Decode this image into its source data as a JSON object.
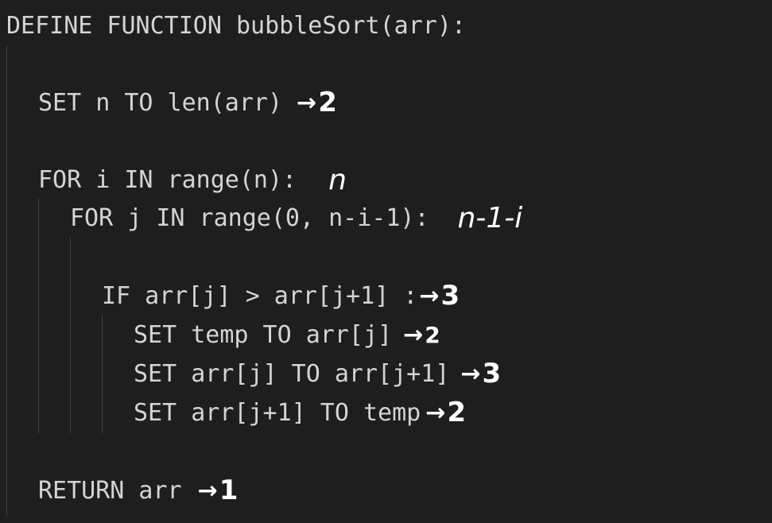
{
  "code": {
    "line1": "DEFINE FUNCTION bubbleSort(arr):",
    "line2": "SET n TO len(arr)",
    "line3": "FOR i IN range(n):",
    "line4": "FOR j IN range(0, n-i-1):",
    "line5": "IF arr[j] > arr[j+1] :",
    "line6": "SET temp TO arr[j]",
    "line7": "SET arr[j] TO arr[j+1]",
    "line8": "SET arr[j+1] TO temp",
    "line9": "RETURN arr"
  },
  "annotations": {
    "arrow": "→",
    "line2_cost": "2",
    "line3_cost": "n",
    "line4_cost": "n-1-i",
    "line5_cost": "3",
    "line6_cost": "2",
    "line7_cost": "3",
    "line8_cost": "2",
    "line9_cost": "1"
  }
}
